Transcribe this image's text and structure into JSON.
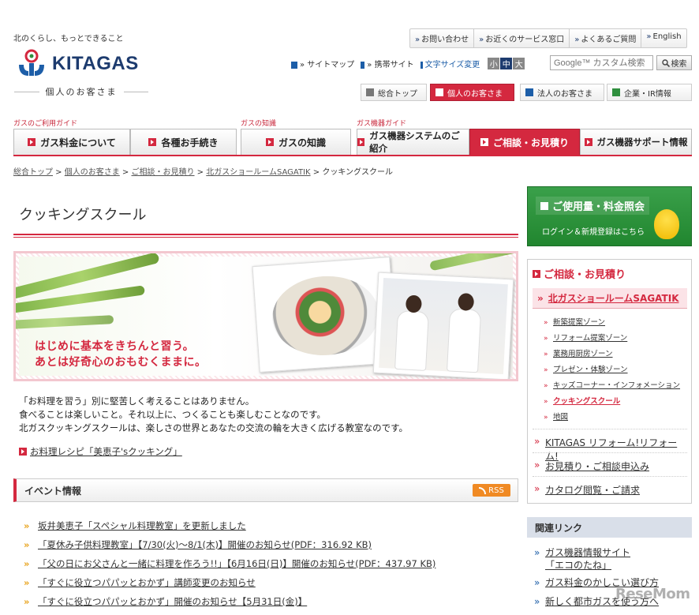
{
  "header": {
    "tagline": "北のくらし、もっとできること",
    "logo_text": "KITAGAS",
    "logo_sub": "個人のお客さま",
    "top_links": [
      "お問い合わせ",
      "お近くのサービス窓口",
      "よくあるご質問",
      "English"
    ],
    "util_links": [
      "サイトマップ",
      "携帯サイト",
      "文字サイズ変更"
    ],
    "font_sizes": [
      "小",
      "中",
      "大"
    ],
    "search_placeholder": "Google™ カスタム検索",
    "search_button": "検索",
    "audience_tabs": [
      "総合トップ",
      "個人のお客さま",
      "法人のお客さま",
      "企業・IR情報"
    ]
  },
  "nav": {
    "group_labels": [
      "ガスのご利用ガイド",
      "ガスの知識",
      "ガス機器ガイド"
    ],
    "items": [
      "ガス料金について",
      "各種お手続き",
      "ガスの知識",
      "ガス機器システムのご紹介",
      "ご相談・お見積り",
      "ガス機器サポート情報"
    ],
    "active_index": 4
  },
  "breadcrumb": {
    "items": [
      "総合トップ",
      "個人のお客さま",
      "ご相談・お見積り",
      "北ガスショールームSAGATIK"
    ],
    "current": "クッキングスクール"
  },
  "main": {
    "title": "クッキングスクール",
    "hero_line1": "はじめに基本をきちんと習う。",
    "hero_line2": "あとは好奇心のおもむくままに。",
    "intro": [
      "「お料理を習う」別に堅苦しく考えることはありません。",
      "食べることは楽しいこと。それ以上に、つくることも楽しむことなのです。",
      "北ガスクッキングスクールは、楽しさの世界とあなたの交流の輪を大きく広げる教室なのです。"
    ],
    "recipe_link": "お料理レシピ「美恵子'sクッキング」",
    "events_title": "イベント情報",
    "rss_label": "RSS",
    "events": [
      "坂井美恵子「スペシャル料理教室」を更新しました",
      "「夏休み子供料理教室」【7/30(火)〜8/1(木)】開催のお知らせ(PDF：316.92 KB)",
      "「父の日にお父さんと一緒に料理を作ろう!!」【6月16日(日)】開催のお知らせ(PDF：437.97 KB)",
      "「すぐに役立つパパッとおかず」講師変更のお知らせ",
      "「すぐに役立つパパッとおかず」開催のお知らせ【5月31日(金)】"
    ]
  },
  "sidebar": {
    "usage_title": "ご使用量・料金照会",
    "usage_sub": "ログイン＆新規登録はこちら",
    "section_title": "ご相談・お見積り",
    "showroom": "北ガスショールームSAGATIK",
    "sub_items": [
      "新築提案ゾーン",
      "リフォーム提案ゾーン",
      "業務用厨房ゾーン",
      "プレゼン・体験ゾーン",
      "キッズコーナー・インフォメーション",
      "クッキングスクール",
      "地図"
    ],
    "current_sub_index": 5,
    "links": [
      "KITAGAS リフォーム!リフォーム!",
      "お見積り・ご相談申込み",
      "カタログ閲覧・ご請求"
    ],
    "related_title": "関連リンク",
    "related_links": [
      "ガス機器情報サイト「エコのたね」",
      "ガス料金のかしこい選び方",
      "新しく都市ガスを使う方へ"
    ]
  },
  "watermark": "ReseMom"
}
